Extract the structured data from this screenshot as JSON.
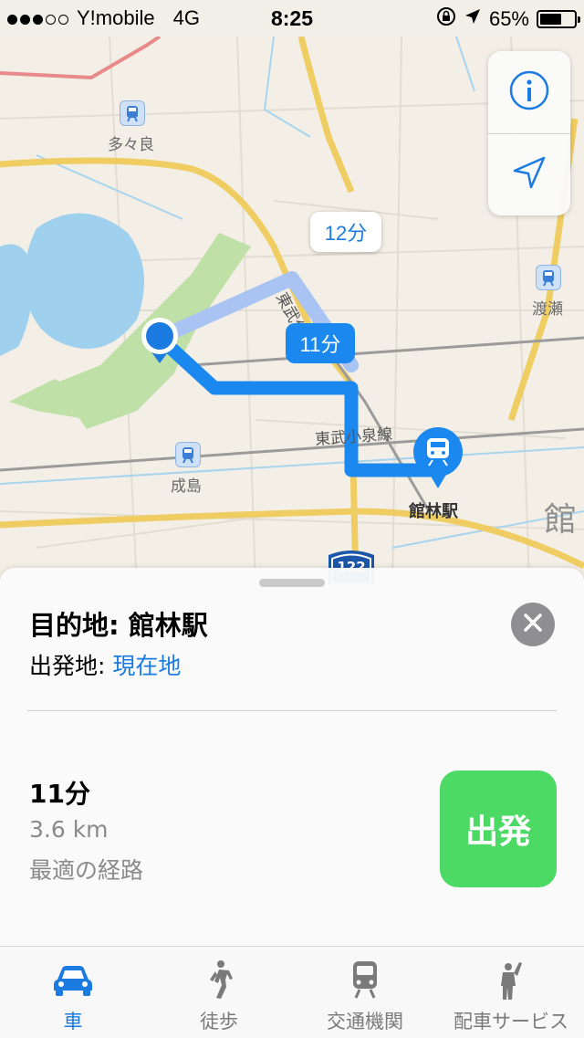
{
  "status_bar": {
    "carrier": "Y!mobile",
    "network": "4G",
    "time": "8:25",
    "battery": "65%",
    "battery_level": 0.65,
    "signal_bars": 3,
    "icons": [
      "rotation-lock-icon",
      "location-arrow-icon",
      "battery-icon"
    ]
  },
  "map": {
    "labels": {
      "station_tatara": "多々良",
      "station_watarase": "渡瀬",
      "station_narushima": "成島",
      "rail_line_isesaki": "東武伊",
      "rail_line_koizumi": "東武小泉線",
      "destination_station": "館林駅",
      "city_label": "館",
      "route_shield": "122"
    },
    "callouts": {
      "alt_route_time": "12分",
      "main_route_time": "11分"
    },
    "controls": {
      "info_icon": "info-icon",
      "location_icon": "location-arrow-icon"
    },
    "colors": {
      "route_main": "#1b88ef",
      "route_alt": "#a9c4f2",
      "park": "#bfe0a6",
      "water": "#9fd0ee"
    }
  },
  "sheet": {
    "destination_label": "目的地: 館林駅",
    "origin_prefix": "出発地: ",
    "origin_value": "現在地",
    "duration": "11分",
    "distance": "3.6 km",
    "route_desc": "最適の経路",
    "go_label": "出発"
  },
  "tabs": [
    {
      "label": "車",
      "icon": "car-icon",
      "active": true
    },
    {
      "label": "徒歩",
      "icon": "walking-person-icon",
      "active": false
    },
    {
      "label": "交通機関",
      "icon": "train-icon",
      "active": false
    },
    {
      "label": "配車サービス",
      "icon": "hailing-person-icon",
      "active": false
    }
  ],
  "accent_color": "#1b7be0",
  "go_button_color": "#4cd964"
}
